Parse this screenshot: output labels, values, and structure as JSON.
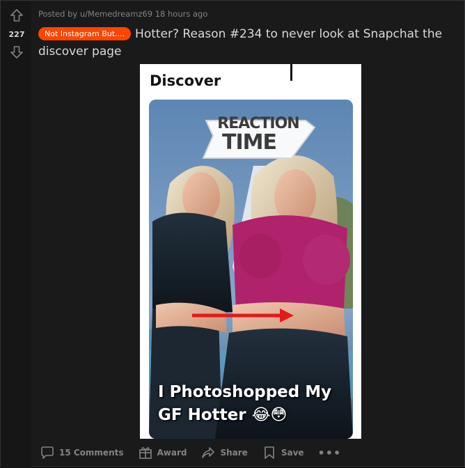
{
  "post": {
    "meta": "Posted by u/Memedreamz69 18 hours ago",
    "score": "227",
    "flair": "Not Instagram But....",
    "title": "Hotter? Reason #234 to never look at Snapchat the discover page"
  },
  "media": {
    "heading": "Discover",
    "badge_line1": "REACTION",
    "badge_line2": "TIME",
    "caption": "I Photoshopped My GF Hotter 😂😳"
  },
  "actions": {
    "comments": "15 Comments",
    "award": "Award",
    "share": "Share",
    "save": "Save",
    "more": "•••"
  },
  "colors": {
    "flair_bg": "#ff4500",
    "background": "#1a1a1b",
    "muted_text": "#818384",
    "text": "#d7dadc"
  },
  "icons": [
    "upvote-icon",
    "downvote-icon",
    "comment-icon",
    "award-icon",
    "share-icon",
    "save-icon",
    "more-icon"
  ]
}
